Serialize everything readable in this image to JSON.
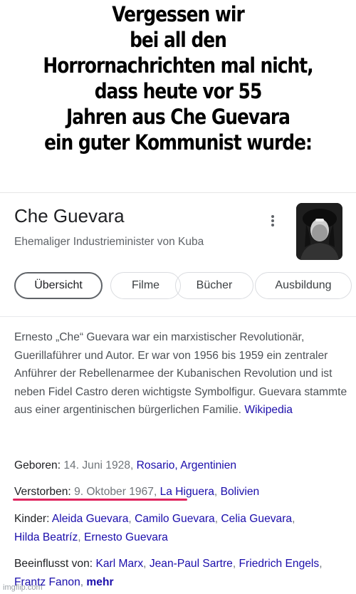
{
  "caption": {
    "lines": [
      "Vergessen wir",
      "bei all den",
      "Horrornachrichten mal nicht,",
      "dass heute vor 55",
      "Jahren aus Che Guevara",
      "ein guter Kommunist wurde:"
    ]
  },
  "panel": {
    "title": "Che Guevara",
    "subtitle": "Ehemaliger Industrieminister von Kuba",
    "more_icon": "more-vert-icon",
    "tabs": [
      "Übersicht",
      "Filme",
      "Bücher",
      "Ausbildung"
    ],
    "description": {
      "text": "Ernesto „Che“ Guevara war ein marxistischer Revolutionär, Guerillaführer und Autor. Er war von 1956 bis 1959 ein zentraler Anführer der Rebellenarmee der Kubanischen Revolution und ist neben Fidel Castro deren wichtigste Symbolfigur. Guevara stammte aus einer argentinischen bürgerlichen Familie. ",
      "source": "Wikipedia"
    },
    "facts": {
      "born": {
        "label": "Geboren",
        "date": "14. Juni 1928",
        "place": "Rosario, Argentinien"
      },
      "died": {
        "label": "Verstorben",
        "date": "9. Oktober 1967",
        "place1": "La Higuera",
        "place2": "Bolivien"
      },
      "children": {
        "label": "Kinder",
        "names": [
          "Aleida Guevara",
          "Camilo Guevara",
          "Celia Guevara",
          "Hilda Beatríz",
          "Ernesto Guevara"
        ]
      },
      "influenced": {
        "label": "Beeinflusst von",
        "names": [
          "Karl Marx",
          "Jean-Paul Sartre",
          "Friedrich Engels",
          "Frantz Fanon"
        ],
        "more": "mehr"
      }
    }
  },
  "watermark": "imgflip.com",
  "colors": {
    "link": "#1a0dab",
    "text": "#4d5156",
    "underline": "#e0245e"
  }
}
